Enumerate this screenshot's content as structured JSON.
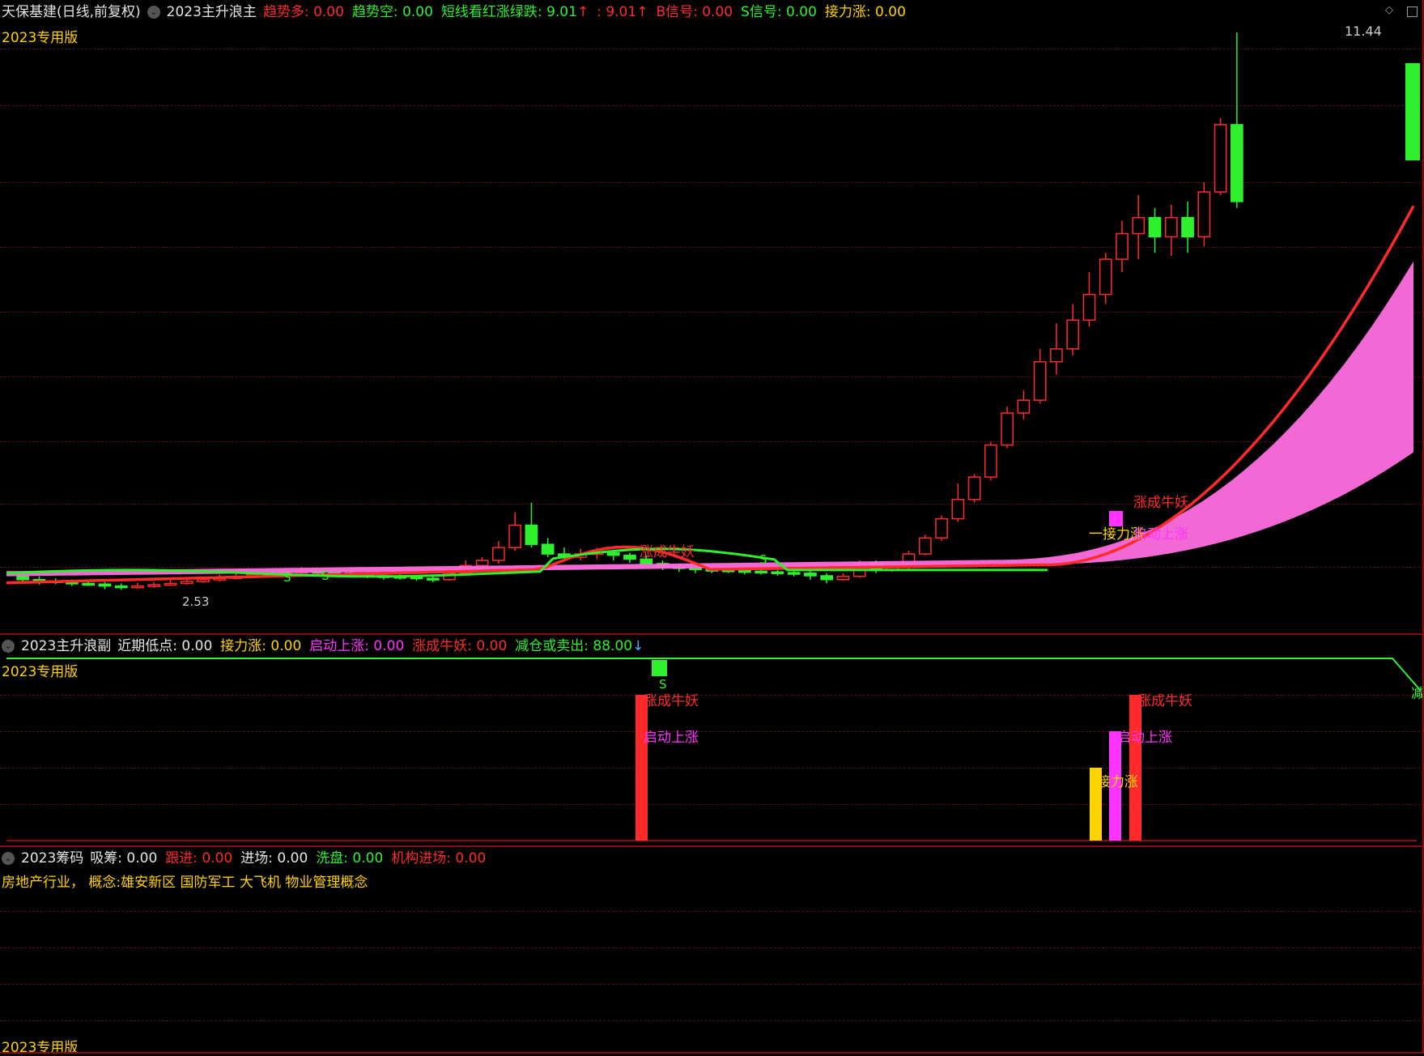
{
  "main_panel": {
    "stock_title": "天保基建(日线,前复权)",
    "indicator_name": "2023主升浪主",
    "version_label": "2023专用版",
    "indicators": [
      {
        "label": "趋势多",
        "value": "0.00",
        "label_color": "#ff2b2b",
        "value_color": "#ff2b2b"
      },
      {
        "label": "趋势空",
        "value": "0.00",
        "label_color": "#2ef02e",
        "value_color": "#2ef02e"
      },
      {
        "label": "短线看红涨绿跌",
        "value": "9.01",
        "label_color": "#2ef02e",
        "value_color": "#2ef02e"
      },
      {
        "label": "",
        "value": "9.01",
        "label_color": "#ff2b2b",
        "value_color": "#ff2b2b"
      },
      {
        "label": "B信号",
        "value": "0.00",
        "label_color": "#ff2b2b",
        "value_color": "#ff2b2b"
      },
      {
        "label": "S信号",
        "value": "0.00",
        "label_color": "#2ef02e",
        "value_color": "#2ef02e"
      },
      {
        "label": "接力涨",
        "value": "0.00",
        "label_color": "#ffd200",
        "value_color": "#ffd200"
      }
    ],
    "price_high_label": "11.44",
    "price_low_label": "2.53",
    "chart_labels": {
      "zhang_cheng_niu_yao": "涨成牛妖",
      "qi_dong_shang_zhang": "启动上涨",
      "jie_li_zhang": "一接力涨",
      "s_mark": "S",
      "mid_annotation": "涨成牛妖"
    }
  },
  "sub_panel": {
    "indicator_name": "2023主升浪副",
    "version_label": "2023专用版",
    "indicators": [
      {
        "label": "近期低点",
        "value": "0.00",
        "label_color": "#e6e6e6",
        "value_color": "#e6e6e6"
      },
      {
        "label": "接力涨",
        "value": "0.00",
        "label_color": "#ffd200",
        "value_color": "#ffd200"
      },
      {
        "label": "启动上涨",
        "value": "0.00",
        "label_color": "#ff33ff",
        "value_color": "#ff33ff"
      },
      {
        "label": "涨成牛妖",
        "value": "0.00",
        "label_color": "#ff2b2b",
        "value_color": "#ff2b2b"
      },
      {
        "label": "减仓或卖出",
        "value": "88.00",
        "label_color": "#2ef02e",
        "value_color": "#2ef02e"
      }
    ],
    "labels": {
      "bull": "涨成牛妖",
      "start": "启动上涨",
      "relay": "接力涨",
      "s_mark": "S",
      "reduce_short": "减"
    }
  },
  "chip_panel": {
    "indicator_name": "2023筹码",
    "version_label": "2023专用版",
    "indicators": [
      {
        "label": "吸筹",
        "value": "0.00",
        "label_color": "#e6e6e6",
        "value_color": "#e6e6e6"
      },
      {
        "label": "跟进",
        "value": "0.00",
        "label_color": "#ff2b2b",
        "value_color": "#ff2b2b"
      },
      {
        "label": "进场",
        "value": "0.00",
        "label_color": "#e6e6e6",
        "value_color": "#e6e6e6"
      },
      {
        "label": "洗盘",
        "value": "0.00",
        "label_color": "#2ef02e",
        "value_color": "#2ef02e"
      },
      {
        "label": "机构进场",
        "value": "0.00",
        "label_color": "#ff2b2b",
        "value_color": "#ff2b2b"
      }
    ],
    "concept_text": "房地产行业，  概念:雄安新区 国防军工 大飞机 物业管理概念"
  },
  "colors": {
    "background": "#000000",
    "up": "#ff2b2b",
    "down": "#2ef02e",
    "band": "#ff6ee0",
    "grid": "#5a0d14",
    "yellow": "#ffd200",
    "magenta": "#ff33ff"
  },
  "icons": [
    "options-circle-icon",
    "diamond-icon",
    "window-icon",
    "up-arrow-icon",
    "down-arrow-icon"
  ]
}
